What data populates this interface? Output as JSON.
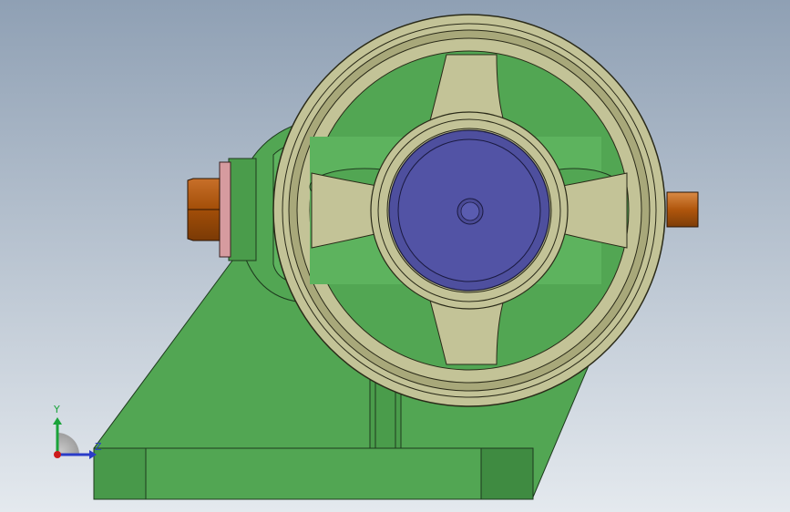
{
  "viewport": {
    "background_top": "#8fa0b4",
    "background_bottom": "#e4e9ee"
  },
  "model": {
    "parts": [
      "base-plate",
      "support-bracket",
      "bearing-housing",
      "handwheel",
      "hub-cap",
      "shaft-nut",
      "shaft-end"
    ],
    "colors": {
      "body_green": "#52a653",
      "body_green_dark": "#3d8a3f",
      "wheel": "#c3c397",
      "wheel_dark": "#9d9d6e",
      "hub_blue": "#4e4f9e",
      "nut_orange": "#b0560c",
      "washer_pink": "#d69b9f"
    }
  },
  "triad": {
    "y_label": "Y",
    "z_label": "Z",
    "y_color": "#1aa33a",
    "z_color": "#2a3cc8",
    "origin_color": "#cc1b1b"
  }
}
